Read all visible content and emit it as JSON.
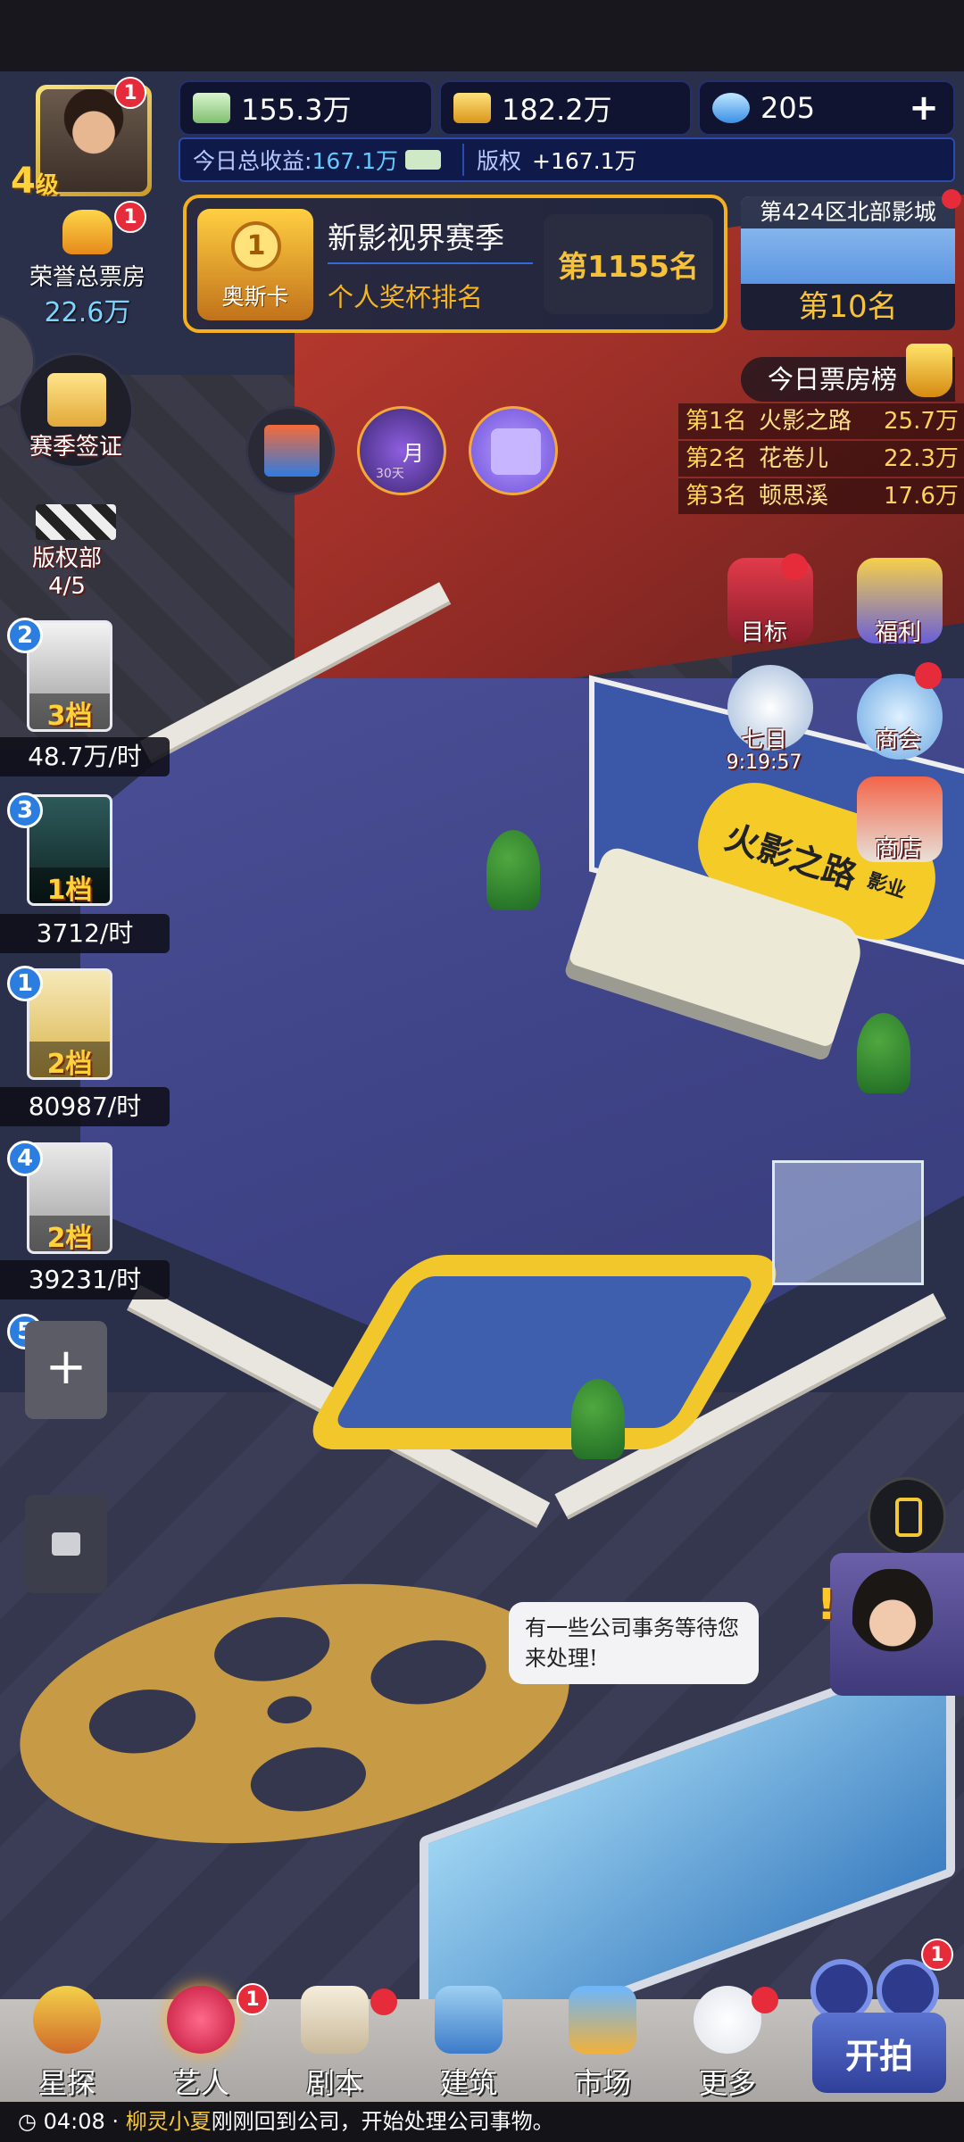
{
  "player": {
    "level_number": "4",
    "level_unit": "级",
    "avatar_badge": "1",
    "honor_badge": "1",
    "honor_label": "荣誉总票房",
    "honor_value": "22.6万"
  },
  "resources": {
    "cash": "155.3万",
    "gold": "182.2万",
    "diamonds": "205",
    "add_symbol": "+",
    "income_label": "今日总收益:",
    "income_value": "167.1万",
    "copyright_label": "版权",
    "copyright_value": "+167.1万"
  },
  "season": {
    "card_label": "奥斯卡",
    "medal_number": "1",
    "title": "新影视界赛季",
    "subtitle": "个人奖杯排名",
    "rank": "第1155名"
  },
  "region": {
    "title": "第424区北部影城",
    "rank": "第10名"
  },
  "box_office_board": {
    "title": "今日票房榜",
    "rows": [
      {
        "rank": "第1名",
        "name": "火影之路",
        "value": "25.7万"
      },
      {
        "rank": "第2名",
        "name": "花卷儿",
        "value": "22.3万"
      },
      {
        "rank": "第3名",
        "name": "顿思溪",
        "value": "17.6万"
      }
    ]
  },
  "left_menu": {
    "season_visa": "赛季签证",
    "copyright_dept": "版权部",
    "copyright_count": "4/5"
  },
  "center_icons": {
    "month_card": "月",
    "month_card_days": "30天"
  },
  "right_menu": {
    "goal": "目标",
    "welfare": "福利",
    "seven_day": "七日",
    "seven_day_timer": "9:19:57",
    "chamber": "商会",
    "shop": "商店"
  },
  "artists": [
    {
      "slot": "2",
      "tier": "3档",
      "rate": "48.7万/时"
    },
    {
      "slot": "3",
      "tier": "1档",
      "rate": "3712/时"
    },
    {
      "slot": "1",
      "tier": "2档",
      "rate": "80987/时"
    },
    {
      "slot": "4",
      "tier": "2档",
      "rate": "39231/时"
    }
  ],
  "add_slot": {
    "number": "5",
    "symbol": "+"
  },
  "scene": {
    "company_sign": "火影之路",
    "company_sign_sub": "影业"
  },
  "dialog": {
    "text": "有一些公司事务等待您来处理!",
    "exclaim": "!"
  },
  "bottom_nav": {
    "items": [
      {
        "label": "星探",
        "icon": "scout-icon"
      },
      {
        "label": "艺人",
        "icon": "artist-icon",
        "badge": "1"
      },
      {
        "label": "剧本",
        "icon": "script-icon"
      },
      {
        "label": "建筑",
        "icon": "building-icon"
      },
      {
        "label": "市场",
        "icon": "market-icon"
      },
      {
        "label": "更多",
        "icon": "more-icon"
      }
    ],
    "shoot_label": "开拍",
    "shoot_badge": "1"
  },
  "status": {
    "time": "04:08",
    "separator": "·",
    "name": "柳灵小夏",
    "message": "刚刚回到公司，开始处理公司事物。"
  },
  "colors": {
    "accent_gold": "#f4b11d",
    "badge_red": "#e62b3a",
    "value_blue": "#63c9ff"
  }
}
